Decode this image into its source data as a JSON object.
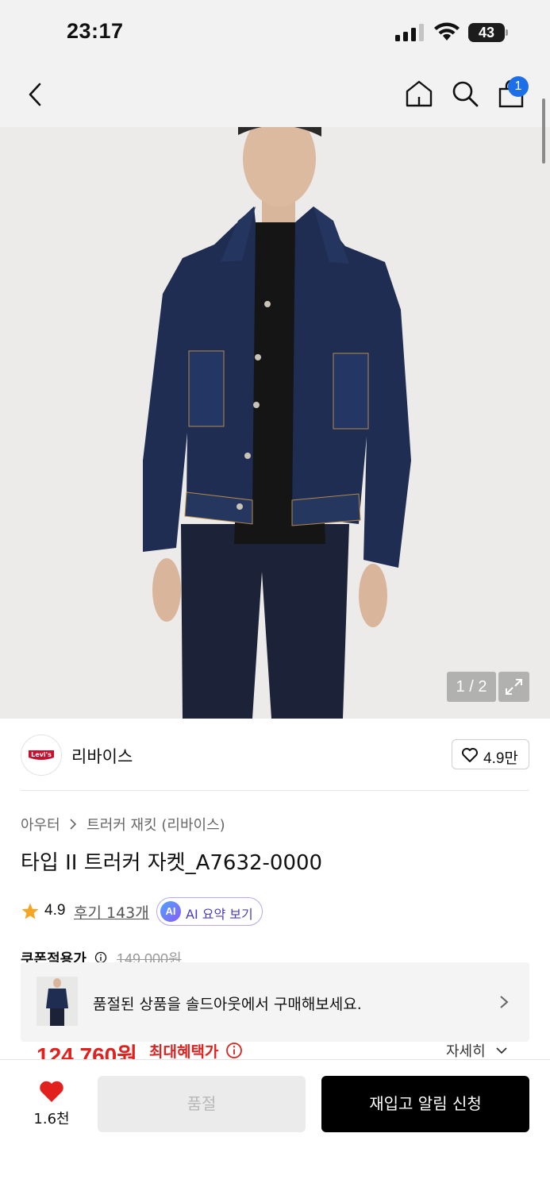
{
  "status_bar": {
    "time": "23:17",
    "battery_level": "43"
  },
  "nav": {
    "cart_badge": "1",
    "icons": [
      "back-icon",
      "home-icon",
      "search-icon",
      "shopping-bag-icon"
    ]
  },
  "gallery": {
    "counter": "1 / 2"
  },
  "brand": {
    "logo_text": "Levi's",
    "name": "리바이스",
    "like_count": "4.9만"
  },
  "breadcrumb": {
    "category": "아우터",
    "subcategory": "트러커 재킷 (리바이스)"
  },
  "product": {
    "title": "타입 II 트러커 자켓_A7632-0000",
    "rating": "4.9",
    "reviews": "후기 143개",
    "ai_badge": "AI",
    "ai_summary": "AI 요약 보기",
    "coupon_label": "쿠폰적용가",
    "original_price": "149,000원",
    "sale_price": "124,760원",
    "max_benefit": "최대혜택가",
    "detail_link": "자세히"
  },
  "soldout_banner": {
    "text": "품절된 상품을 솔드아웃에서 구매해보세요."
  },
  "bottom_bar": {
    "wish_count": "1.6천",
    "soldout_label": "품절",
    "restock_label": "재입고 알림 신청"
  },
  "colors": {
    "accent_red": "#e0211d",
    "badge_blue": "#1d6fe8",
    "cta_black": "#000000"
  }
}
